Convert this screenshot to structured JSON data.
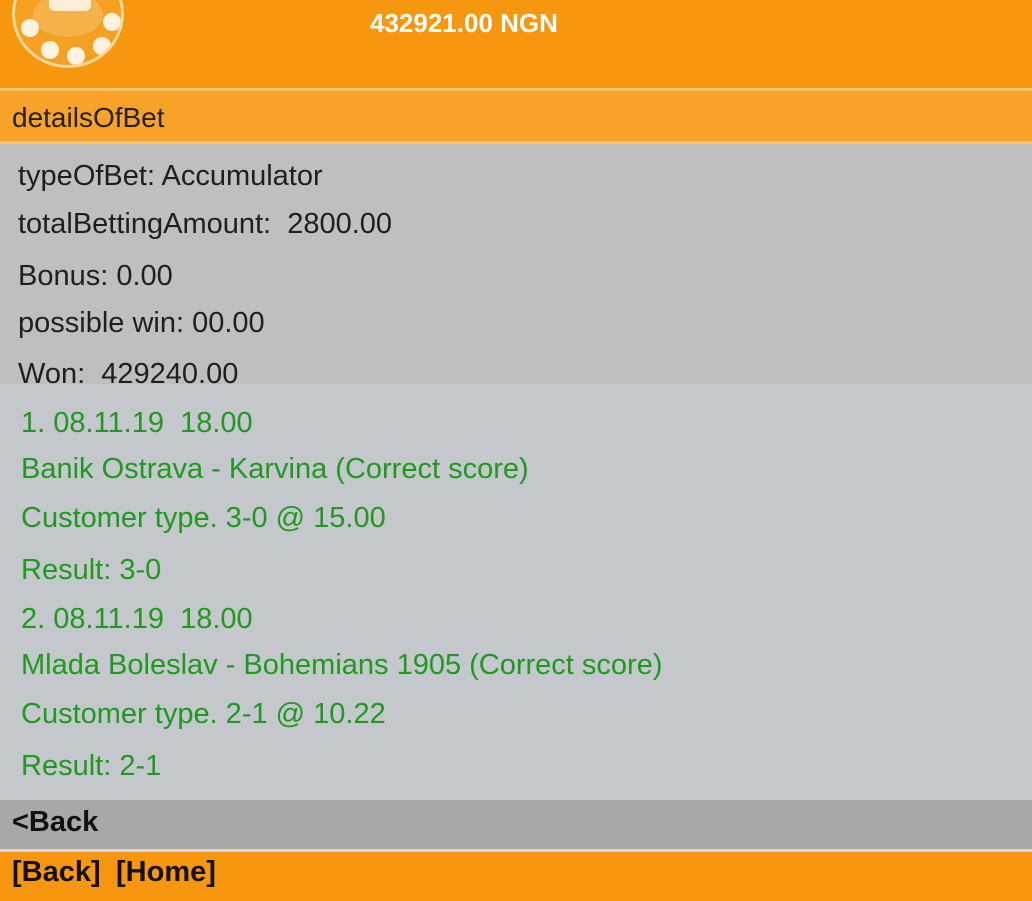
{
  "header": {
    "balance": "432921.00 NGN"
  },
  "title": "detailsOfBet",
  "summary": {
    "type_of_bet": "typeOfBet: Accumulator",
    "total_betting_amount": "totalBettingAmount:  2800.00",
    "bonus": "Bonus: 0.00",
    "possible_win": "possible win: 00.00",
    "won": "Won:  429240.00"
  },
  "events": [
    {
      "datetime": "1. 08.11.19  18.00",
      "match": "Banik Ostrava - Karvina (Correct score)",
      "customer_type": "Customer type. 3-0 @ 15.00",
      "result": "Result: 3-0"
    },
    {
      "datetime": "2. 08.11.19  18.00",
      "match": "Mlada Boleslav - Bohemians 1905 (Correct score)",
      "customer_type": "Customer type. 2-1 @ 10.22",
      "result": "Result: 2-1"
    }
  ],
  "nav": {
    "back_link": "<Back",
    "footer_back": "[Back]",
    "footer_home": "[Home]"
  },
  "colors": {
    "header_orange": "#f7970f",
    "event_green": "#1f9a1f",
    "summary_gray": "#bfbfbf",
    "details_gray": "#c4c7cb"
  }
}
